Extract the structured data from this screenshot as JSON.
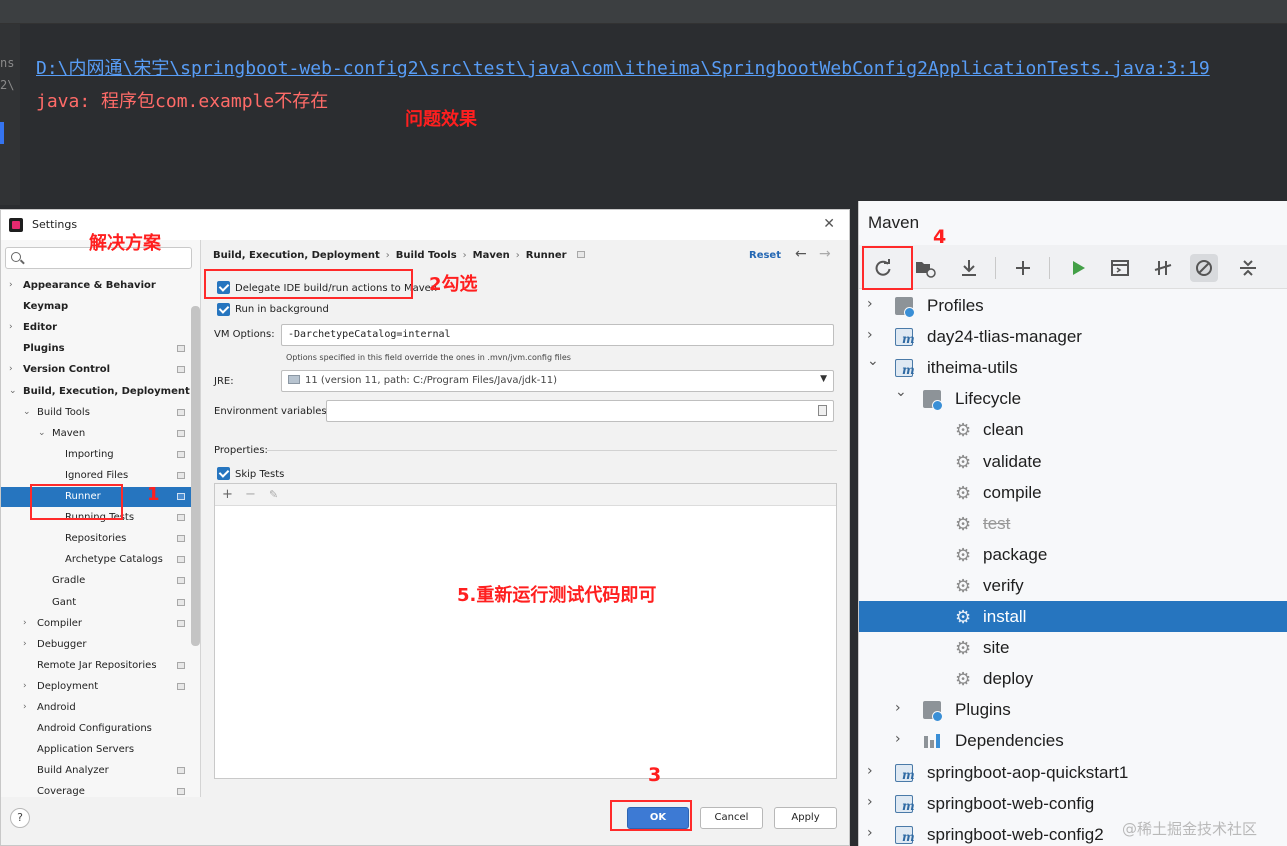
{
  "console": {
    "gutter_top": "ns",
    "gutter_bottom": "2\\",
    "link": "D:\\内网通\\宋宇\\springboot-web-config2\\src\\test\\java\\com\\itheima\\SpringbootWebConfig2ApplicationTests.java:3:19",
    "error": "java: 程序包com.example不存在"
  },
  "annotations": {
    "problem": "问题效果",
    "solution": "解决方案",
    "step1": "1",
    "step2": "2勾选",
    "step3": "3",
    "step4": "4",
    "step5": "5.重新运行测试代码即可"
  },
  "dialog": {
    "title": "Settings",
    "close_icon": "close-icon",
    "search_placeholder": "Q-",
    "tree": [
      {
        "label": "Appearance & Behavior",
        "level": 0,
        "chevron": "right",
        "bold": true
      },
      {
        "label": "Keymap",
        "level": 0,
        "bold": true
      },
      {
        "label": "Editor",
        "level": 0,
        "chevron": "right",
        "bold": true
      },
      {
        "label": "Plugins",
        "level": 0,
        "bold": true,
        "badge": true
      },
      {
        "label": "Version Control",
        "level": 0,
        "chevron": "right",
        "bold": true,
        "badge": true
      },
      {
        "label": "Build, Execution, Deployment",
        "level": 0,
        "chevron": "down",
        "bold": true
      },
      {
        "label": "Build Tools",
        "level": 1,
        "chevron": "down",
        "badge": true
      },
      {
        "label": "Maven",
        "level": 2,
        "chevron": "down",
        "badge": true
      },
      {
        "label": "Importing",
        "level": 3,
        "badge": true
      },
      {
        "label": "Ignored Files",
        "level": 3,
        "badge": true
      },
      {
        "label": "Runner",
        "level": 3,
        "badge": true,
        "selected": true
      },
      {
        "label": "Running Tests",
        "level": 3,
        "badge": true
      },
      {
        "label": "Repositories",
        "level": 3,
        "badge": true
      },
      {
        "label": "Archetype Catalogs",
        "level": 3,
        "badge": true
      },
      {
        "label": "Gradle",
        "level": 2,
        "badge": true
      },
      {
        "label": "Gant",
        "level": 2,
        "badge": true
      },
      {
        "label": "Compiler",
        "level": 1,
        "chevron": "right",
        "badge": true
      },
      {
        "label": "Debugger",
        "level": 1,
        "chevron": "right"
      },
      {
        "label": "Remote Jar Repositories",
        "level": 1,
        "badge": true
      },
      {
        "label": "Deployment",
        "level": 1,
        "chevron": "right",
        "badge": true
      },
      {
        "label": "Android",
        "level": 1,
        "chevron": "right"
      },
      {
        "label": "Android Configurations",
        "level": 1
      },
      {
        "label": "Application Servers",
        "level": 1
      },
      {
        "label": "Build Analyzer",
        "level": 1,
        "badge": true
      },
      {
        "label": "Coverage",
        "level": 1,
        "badge": true
      }
    ],
    "breadcrumb": [
      "Build, Execution, Deployment",
      "Build Tools",
      "Maven",
      "Runner"
    ],
    "reset": "Reset",
    "delegate_label": "Delegate IDE build/run actions to Maven",
    "delegate_checked": true,
    "background_label": "Run in background",
    "background_checked": true,
    "vm_options_label": "VM Options:",
    "vm_options_value": "-DarchetypeCatalog=internal",
    "vm_options_hint": "Options specified in this field override the ones in .mvn/jvm.config files",
    "jre_label": "JRE:",
    "jre_value": "11 (version 11, path: C:/Program Files/Java/jdk-11)",
    "env_label": "Environment variables:",
    "env_value": "",
    "properties_label": "Properties:",
    "skip_tests_label": "Skip Tests",
    "skip_tests_checked": true,
    "buttons": {
      "ok": "OK",
      "cancel": "Cancel",
      "apply": "Apply",
      "help": "?"
    }
  },
  "maven": {
    "title": "Maven",
    "toolbar": [
      "reload-icon",
      "folder-generate-icon",
      "download-icon",
      "add-icon",
      "run-icon",
      "execute-goal-icon",
      "toggle-offline-icon",
      "skip-tests-icon",
      "collapse-icon"
    ],
    "tree": [
      {
        "label": "Profiles",
        "level": 0,
        "chevron": "right",
        "icon": "profiles-icon"
      },
      {
        "label": "day24-tlias-manager",
        "level": 0,
        "chevron": "right",
        "icon": "maven-module-icon"
      },
      {
        "label": "itheima-utils",
        "level": 0,
        "chevron": "down",
        "icon": "maven-module-icon"
      },
      {
        "label": "Lifecycle",
        "level": 1,
        "chevron": "down",
        "icon": "lifecycle-folder-icon"
      },
      {
        "label": "clean",
        "level": 2,
        "icon": "gear-icon"
      },
      {
        "label": "validate",
        "level": 2,
        "icon": "gear-icon"
      },
      {
        "label": "compile",
        "level": 2,
        "icon": "gear-icon"
      },
      {
        "label": "test",
        "level": 2,
        "icon": "gear-icon",
        "strike": true
      },
      {
        "label": "package",
        "level": 2,
        "icon": "gear-icon"
      },
      {
        "label": "verify",
        "level": 2,
        "icon": "gear-icon"
      },
      {
        "label": "install",
        "level": 2,
        "icon": "gear-icon",
        "selected": true
      },
      {
        "label": "site",
        "level": 2,
        "icon": "gear-icon"
      },
      {
        "label": "deploy",
        "level": 2,
        "icon": "gear-icon"
      },
      {
        "label": "Plugins",
        "level": 1,
        "chevron": "right",
        "icon": "plugins-folder-icon"
      },
      {
        "label": "Dependencies",
        "level": 1,
        "chevron": "right",
        "icon": "dependencies-icon"
      },
      {
        "label": "springboot-aop-quickstart1",
        "level": 0,
        "chevron": "right",
        "icon": "maven-module-icon"
      },
      {
        "label": "springboot-web-config",
        "level": 0,
        "chevron": "right",
        "icon": "maven-module-icon"
      },
      {
        "label": "springboot-web-config2",
        "level": 0,
        "chevron": "right",
        "icon": "maven-module-icon"
      }
    ]
  },
  "watermark": "@稀土掘金技术社区",
  "colors": {
    "accent": "#2675bf",
    "annotation_red": "#ff1f1f",
    "error_red": "#ff6b68",
    "link_blue": "#589df6",
    "run_green": "#43a047"
  }
}
